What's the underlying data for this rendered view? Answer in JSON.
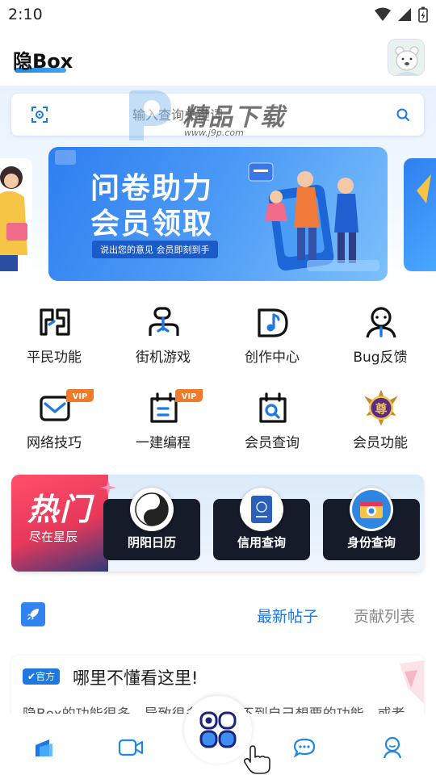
{
  "status_bar": {
    "time": "2:10"
  },
  "header": {
    "logo": "隐Box"
  },
  "search": {
    "placeholder": "输入查询关键词",
    "watermark_title": "精品下载",
    "watermark_url": "www.j9p.com"
  },
  "banner": {
    "line1": "问卷助力",
    "line2": "会员领取",
    "sub": "说出您的意见 会员即刻到手"
  },
  "features": [
    {
      "label": "平民功能",
      "icon": "grid-icon"
    },
    {
      "label": "街机游戏",
      "icon": "gamepad-icon"
    },
    {
      "label": "创作中心",
      "icon": "music-note-icon"
    },
    {
      "label": "Bug反馈",
      "icon": "person-feedback-icon"
    },
    {
      "label": "网络技巧",
      "icon": "mail-icon",
      "badge": "VIP"
    },
    {
      "label": "一建编程",
      "icon": "code-calendar-icon",
      "badge": "VIP"
    },
    {
      "label": "会员查询",
      "icon": "search-calendar-icon"
    },
    {
      "label": "会员功能",
      "icon": "crown-badge-icon",
      "badge_glyph": "尊"
    }
  ],
  "hot": {
    "title": "热门",
    "subtitle": "尽在星辰",
    "tiles": [
      {
        "label": "阴阳日历",
        "icon": "yin-yang-icon"
      },
      {
        "label": "信用查询",
        "icon": "passport-icon"
      },
      {
        "label": "身份查询",
        "icon": "camera-icon"
      }
    ]
  },
  "posts": {
    "tab_latest": "最新帖子",
    "tab_contrib": "贡献列表",
    "card": {
      "badge": "官方",
      "title": "哪里不懂看这里!",
      "excerpt": "隐Box的功能很多，导致很多用户找不到自己想要的功能，或者"
    }
  },
  "nav": {
    "items": [
      "home-icon",
      "video-icon",
      "apps-icon",
      "chat-icon",
      "profile-icon"
    ]
  },
  "colors": {
    "accent": "#1e78e0",
    "hot_red": "#e8385a"
  }
}
